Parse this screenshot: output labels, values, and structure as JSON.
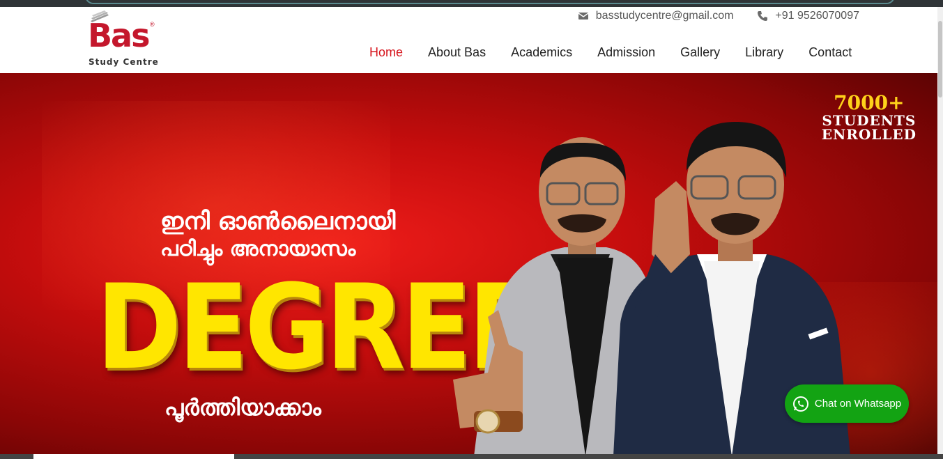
{
  "header": {
    "logo": {
      "word": "Bas",
      "registered": "®",
      "subtitle": "Study Centre"
    },
    "contact": {
      "email": "basstudycentre@gmail.com",
      "phone": "+91 9526070097"
    },
    "nav": [
      {
        "label": "Home",
        "active": true
      },
      {
        "label": "About Bas"
      },
      {
        "label": "Academics"
      },
      {
        "label": "Admission"
      },
      {
        "label": "Gallery"
      },
      {
        "label": "Library"
      },
      {
        "label": "Contact"
      }
    ]
  },
  "hero": {
    "line1": "ഇനി ഓൺലൈനായി",
    "line2": "പഠിച്ചും അനായാസം",
    "headline": "DEGREE",
    "line3": "പൂർത്തിയാക്കാം",
    "stat_number": "7000+",
    "stat_label_1": "STUDENTS",
    "stat_label_2": "ENROLLED"
  },
  "whatsapp": {
    "label": "Chat on Whatsapp"
  },
  "colors": {
    "brand_red": "#c4172c",
    "nav_active": "#d6141c",
    "whatsapp_green": "#13a313",
    "headline_yellow": "#ffe600"
  }
}
